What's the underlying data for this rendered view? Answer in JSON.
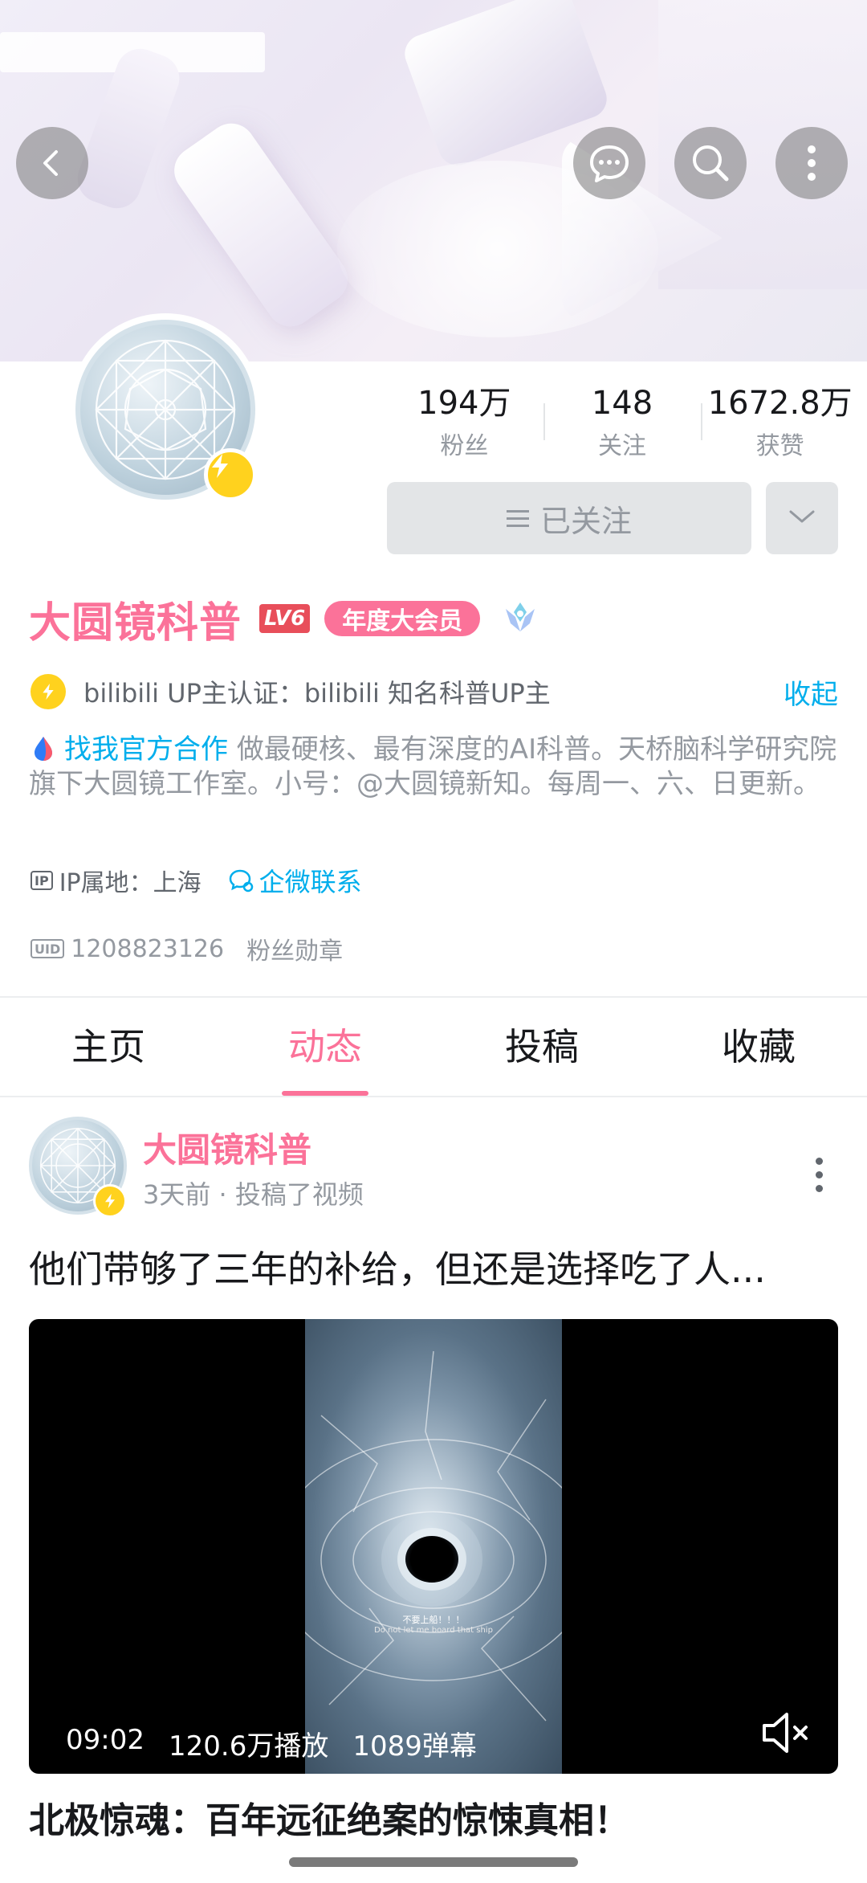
{
  "header": {
    "back_icon": "chevron-left-icon",
    "chat_icon": "chat-bubble-icon",
    "search_icon": "search-icon",
    "more_icon": "more-vertical-icon"
  },
  "profile": {
    "stats": [
      {
        "value": "194万",
        "label": "粉丝"
      },
      {
        "value": "148",
        "label": "关注"
      },
      {
        "value": "1672.8万",
        "label": "获赞"
      }
    ],
    "follow_label": "已关注",
    "name": "大圆镜科普",
    "level": "LV6",
    "vip_label": "年度大会员",
    "verify_text": "bilibili UP主认证：bilibili 知名科普UP主",
    "fold_label": "收起",
    "coop_label": "找我官方合作",
    "bio": "做最硬核、最有深度的AI科普。天桥脑科学研究院旗下大圆镜工作室。小号：@大圆镜新知。每周一、六、日更新。",
    "ip_tag": "IP",
    "ip_text": "IP属地：上海",
    "contact_label": "企微联系",
    "uid_tag": "UID",
    "uid": "1208823126",
    "fan_medal_label": "粉丝勋章"
  },
  "tabs": [
    {
      "label": "主页",
      "active": false
    },
    {
      "label": "动态",
      "active": true
    },
    {
      "label": "投稿",
      "active": false
    },
    {
      "label": "收藏",
      "active": false
    }
  ],
  "post": {
    "author": "大圆镜科普",
    "meta": "3天前 · 投稿了视频",
    "title": "他们带够了三年的补给，但还是选择吃了人...",
    "video": {
      "duration": "09:02",
      "plays": "120.6万播放",
      "danmaku": "1089弹幕",
      "subtitle_cn": "不要上船！！！",
      "subtitle_en": "Do not let me board that ship"
    },
    "video_title": "北极惊魂：百年远征绝案的惊悚真相！"
  },
  "colors": {
    "brand_pink": "#fb7299",
    "link_blue": "#00aeec",
    "badge_yellow": "#ffd21e"
  }
}
